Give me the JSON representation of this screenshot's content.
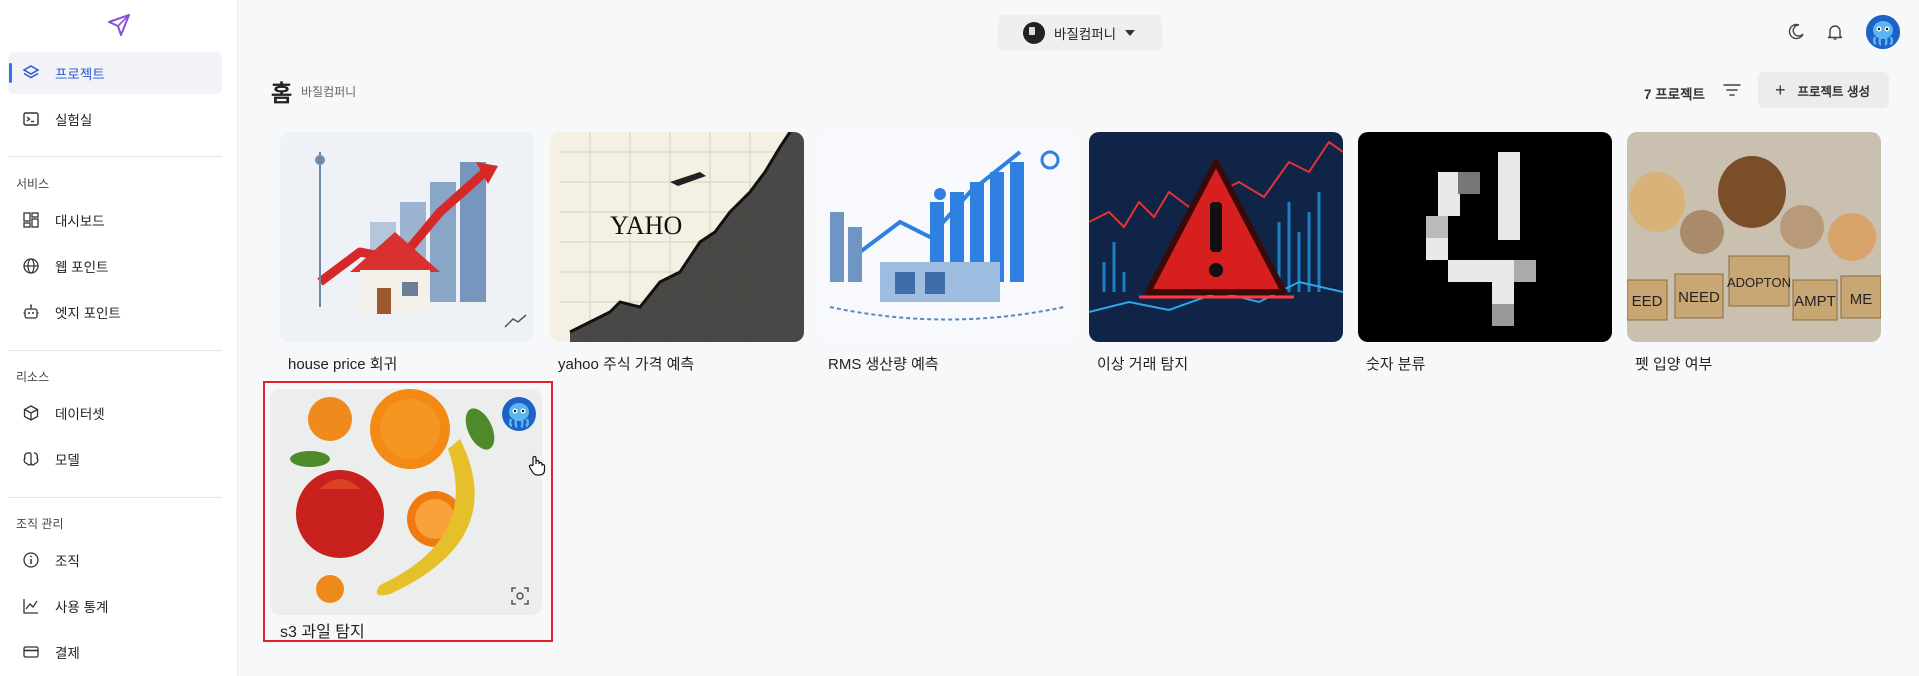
{
  "sidebar": {
    "items": [
      {
        "label": "프로젝트",
        "icon": "layers-icon",
        "active": true
      },
      {
        "label": "실험실",
        "icon": "terminal-icon"
      }
    ],
    "sections": [
      {
        "title": "서비스",
        "items": [
          {
            "label": "대시보드",
            "icon": "dashboard-icon"
          },
          {
            "label": "웹 포인트",
            "icon": "globe-icon"
          },
          {
            "label": "엣지 포인트",
            "icon": "robot-icon"
          }
        ]
      },
      {
        "title": "리소스",
        "items": [
          {
            "label": "데이터셋",
            "icon": "cube-icon"
          },
          {
            "label": "모델",
            "icon": "brain-icon"
          }
        ]
      },
      {
        "title": "조직 관리",
        "items": [
          {
            "label": "조직",
            "icon": "info-icon"
          },
          {
            "label": "사용 통계",
            "icon": "chart-icon"
          },
          {
            "label": "결제",
            "icon": "credit-card-icon"
          }
        ]
      }
    ]
  },
  "header": {
    "workspace": "바질컴퍼니",
    "icons": [
      "moon-icon",
      "bell-icon",
      "user-avatar"
    ]
  },
  "main": {
    "title": "홈",
    "subtitle": "바질컴퍼니",
    "project_count": "7 프로젝트",
    "create_label": "프로젝트 생성",
    "projects": [
      {
        "title": "house price 회귀"
      },
      {
        "title": "yahoo 주식 가격 예측",
        "thumb_text": "YAHO"
      },
      {
        "title": "RMS 생산량 예측"
      },
      {
        "title": "이상 거래 탐지"
      },
      {
        "title": "숫자 분류"
      },
      {
        "title": "펫 입양 여부",
        "signs": [
          "EED",
          "NEED",
          "ADOPTON",
          "AMPT",
          "ME"
        ]
      },
      {
        "title": "s3 과일 탐지",
        "selected": true
      }
    ]
  },
  "colors": {
    "accent": "#3b6ef0",
    "selection": "#e0242a"
  }
}
